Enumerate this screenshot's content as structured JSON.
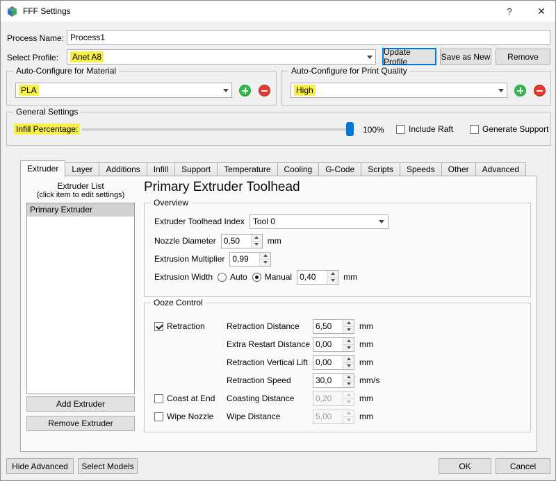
{
  "window": {
    "title": "FFF Settings",
    "help": "?",
    "close": "✕"
  },
  "colors": {
    "highlight": "#f7ef4a",
    "focus_accent": "#0078d7",
    "add_button_green": "#2fb94d",
    "remove_button_red": "#e23b2e",
    "slider_handle_blue": "#0078d7",
    "list_selection_gray": "#d2d2d2"
  },
  "process": {
    "label": "Process Name:",
    "value": "Process1"
  },
  "profile": {
    "label": "Select Profile:",
    "value": "Anet A8",
    "update_button": "Update Profile",
    "save_as_new_button": "Save as New",
    "remove_button": "Remove"
  },
  "auto_material": {
    "title": "Auto-Configure for Material",
    "value": "PLA"
  },
  "auto_quality": {
    "title": "Auto-Configure for Print Quality",
    "value": "High"
  },
  "general": {
    "title": "General Settings",
    "infill_label": "Infill Percentage:",
    "infill_percent": "100%",
    "include_raft": {
      "label": "Include Raft",
      "checked": false
    },
    "generate_support": {
      "label": "Generate Support",
      "checked": false
    }
  },
  "tabs": [
    "Extruder",
    "Layer",
    "Additions",
    "Infill",
    "Support",
    "Temperature",
    "Cooling",
    "G-Code",
    "Scripts",
    "Speeds",
    "Other",
    "Advanced"
  ],
  "active_tab": "Extruder",
  "extruder": {
    "list_title": "Extruder List",
    "list_hint": "(click item to edit settings)",
    "items": [
      "Primary Extruder"
    ],
    "add_button": "Add Extruder",
    "remove_button": "Remove Extruder",
    "heading": "Primary Extruder Toolhead",
    "overview": {
      "title": "Overview",
      "toolhead_index_label": "Extruder Toolhead Index",
      "toolhead_index_value": "Tool 0",
      "nozzle_diameter_label": "Nozzle Diameter",
      "nozzle_diameter_value": "0,50",
      "nozzle_diameter_unit": "mm",
      "extrusion_multiplier_label": "Extrusion Multiplier",
      "extrusion_multiplier_value": "0,99",
      "extrusion_width_label": "Extrusion Width",
      "width_auto_label": "Auto",
      "width_auto_selected": false,
      "width_manual_label": "Manual",
      "width_manual_selected": true,
      "extrusion_width_value": "0,40",
      "extrusion_width_unit": "mm"
    },
    "ooze": {
      "title": "Ooze Control",
      "retraction": {
        "label": "Retraction",
        "checked": true
      },
      "rows": [
        {
          "label": "Retraction Distance",
          "value": "6,50",
          "unit": "mm"
        },
        {
          "label": "Extra Restart Distance",
          "value": "0,00",
          "unit": "mm"
        },
        {
          "label": "Retraction Vertical Lift",
          "value": "0,00",
          "unit": "mm"
        },
        {
          "label": "Retraction Speed",
          "value": "30,0",
          "unit": "mm/s"
        }
      ],
      "coast": {
        "label": "Coast at End",
        "checked": false,
        "row": {
          "label": "Coasting Distance",
          "value": "0,20",
          "unit": "mm",
          "disabled": true
        }
      },
      "wipe": {
        "label": "Wipe Nozzle",
        "checked": false,
        "row": {
          "label": "Wipe Distance",
          "value": "5,00",
          "unit": "mm",
          "disabled": true
        }
      }
    }
  },
  "footer": {
    "hide_advanced_button": "Hide Advanced",
    "select_models_button": "Select Models",
    "ok_button": "OK",
    "cancel_button": "Cancel"
  }
}
